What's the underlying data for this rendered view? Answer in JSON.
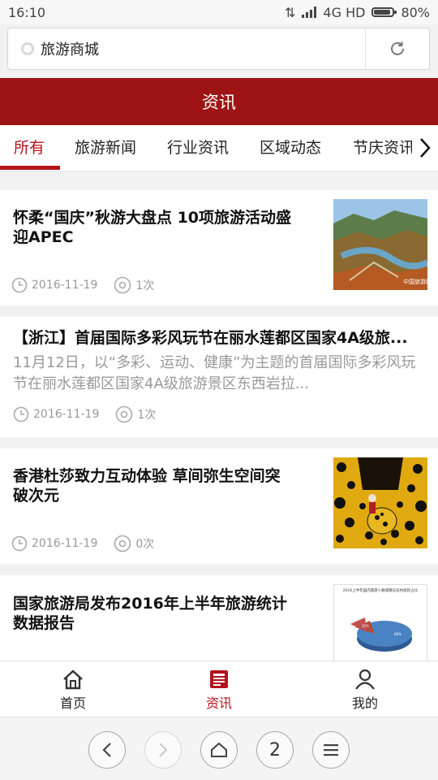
{
  "status_bar": {
    "time": "16:10",
    "network": "4G HD",
    "battery": "80%"
  },
  "url_bar": {
    "text": "旅游商城"
  },
  "header": {
    "title": "资讯"
  },
  "tabs": [
    {
      "label": "所有",
      "active": true
    },
    {
      "label": "旅游新闻"
    },
    {
      "label": "行业资讯"
    },
    {
      "label": "区域动态"
    },
    {
      "label": "节庆资讯"
    }
  ],
  "articles": [
    {
      "title_line1": "怀柔“国庆”秋游大盘点 10项旅游活动盛",
      "title_line2": "迎APEC",
      "date": "2016-11-19",
      "views": "1次",
      "thumb_watermark": "中国旅游网"
    },
    {
      "title": "【浙江】首届国际多彩风玩节在丽水莲都区国家4A级旅...",
      "summary_line1": "11月12日，以“多彩、运动、健康”为主题的首届国际多彩风玩",
      "summary_line2": "节在丽水莲都区国家4A级旅游景区东西岩拉...",
      "date": "2016-11-19",
      "views": "1次"
    },
    {
      "title_line1": "香港杜莎致力互动体验 草间弥生空间突",
      "title_line2": "破次元",
      "date": "2016-11-19",
      "views": "0次"
    },
    {
      "title_line1": "国家旅游局发布2016年上半年旅游统计",
      "title_line2": "数据报告",
      "thumb_caption": "2016上半年国内旅游人数城镇与农村居民占比",
      "pie_label_a": "32%",
      "pie_label_b": "68%"
    }
  ],
  "bottom_nav": [
    {
      "label": "首页",
      "icon": "home-icon"
    },
    {
      "label": "资讯",
      "icon": "news-icon",
      "active": true
    },
    {
      "label": "我的",
      "icon": "user-icon"
    }
  ],
  "browser_bar": {
    "tab_count": "2"
  },
  "colors": {
    "brand": "#9e1414",
    "accent": "#b3131a"
  }
}
